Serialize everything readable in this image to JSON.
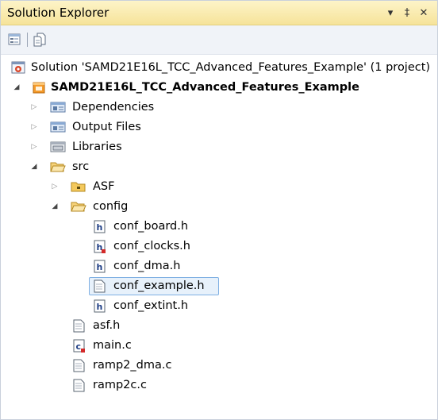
{
  "window": {
    "title": "Solution Explorer",
    "pin_glyph": "▾",
    "autohide_glyph": "‡",
    "close_glyph": "✕"
  },
  "toolbar": {
    "buttons": [
      "properties-icon",
      "show-all-files-icon"
    ]
  },
  "tree": {
    "solution": "Solution 'SAMD21E16L_TCC_Advanced_Features_Example' (1 project)",
    "project": "SAMD21E16L_TCC_Advanced_Features_Example",
    "dependencies": "Dependencies",
    "output_files": "Output Files",
    "libraries": "Libraries",
    "src": "src",
    "asf": "ASF",
    "config": "config",
    "conf_board": "conf_board.h",
    "conf_clocks": "conf_clocks.h",
    "conf_dma": "conf_dma.h",
    "conf_example": "conf_example.h",
    "conf_extint": "conf_extint.h",
    "asf_h": "asf.h",
    "main_c": "main.c",
    "ramp2_dma": "ramp2_dma.c",
    "ramp2c": "ramp2c.c",
    "expanded_glyph": "◢",
    "collapsed_glyph": "▷"
  },
  "colors": {
    "title_bg": "#f6e39a",
    "selection_border": "#7fb0e3",
    "selection_bg": "#e7f1fb"
  }
}
